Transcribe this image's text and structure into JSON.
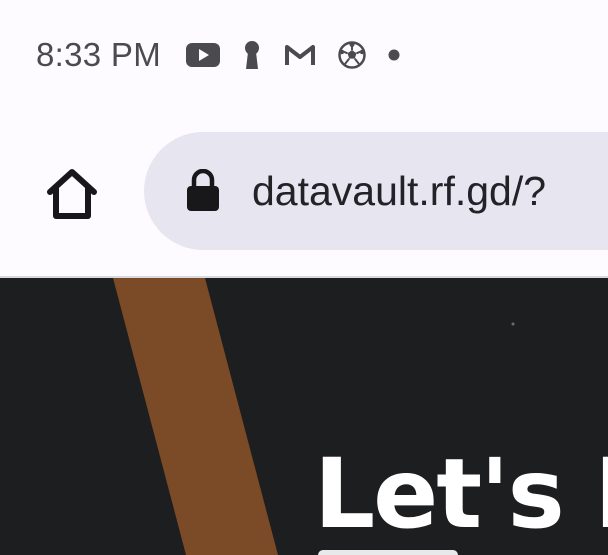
{
  "status_bar": {
    "time": "8:33 PM",
    "icons": [
      "youtube-icon",
      "keyhole-icon",
      "gmail-icon",
      "soccer-ball-icon",
      "notification-dot-icon"
    ]
  },
  "browser": {
    "url": "datavault.rf.gd/?",
    "secure": true
  },
  "page": {
    "heading": "Let's M",
    "colors": {
      "background": "#1c1e1f",
      "stripe": "#7b4a26",
      "heading": "#ffffff"
    }
  },
  "colors": {
    "chrome_background": "#fdfbff",
    "url_pill": "#e7e6f0",
    "text_dark": "#222227",
    "status_text": "#4a4a4f"
  }
}
